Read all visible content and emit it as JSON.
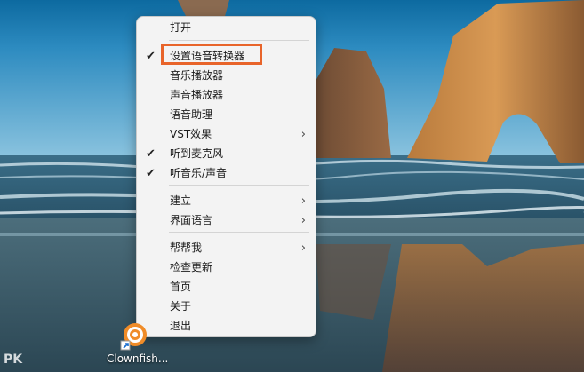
{
  "menu": {
    "items": [
      {
        "label": "打开",
        "checked": false,
        "submenu": false
      },
      {
        "label": "设置语音转换器",
        "checked": true,
        "submenu": false,
        "highlighted": true
      },
      {
        "label": "音乐播放器",
        "checked": false,
        "submenu": false
      },
      {
        "label": "声音播放器",
        "checked": false,
        "submenu": false
      },
      {
        "label": "语音助理",
        "checked": false,
        "submenu": false
      },
      {
        "label": "VST效果",
        "checked": false,
        "submenu": true
      },
      {
        "label": "听到麦克风",
        "checked": true,
        "submenu": false
      },
      {
        "label": "听音乐/声音",
        "checked": true,
        "submenu": false
      },
      {
        "label": "建立",
        "checked": false,
        "submenu": true
      },
      {
        "label": "界面语言",
        "checked": false,
        "submenu": true
      },
      {
        "label": "帮帮我",
        "checked": false,
        "submenu": true
      },
      {
        "label": "检查更新",
        "checked": false,
        "submenu": false
      },
      {
        "label": "首页",
        "checked": false,
        "submenu": false
      },
      {
        "label": "关于",
        "checked": false,
        "submenu": false
      },
      {
        "label": "退出",
        "checked": false,
        "submenu": false
      }
    ],
    "check_glyph": "✔",
    "submenu_glyph": "›"
  },
  "desktop": {
    "icon_label": "Clownfish...",
    "icon_name": "clownfish-app-icon",
    "watermark": "PK"
  },
  "colors": {
    "highlight_border": "#e8642a",
    "menu_bg": "#f3f3f3"
  }
}
